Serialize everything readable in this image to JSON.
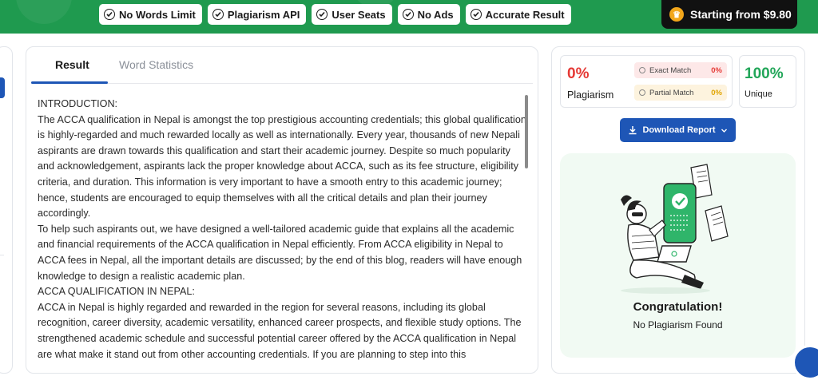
{
  "banner": {
    "features": [
      "No Words Limit",
      "Plagiarism API",
      "User Seats",
      "No Ads",
      "Accurate Result"
    ],
    "promo_label": "Starting from $9.80",
    "accent": "#1f9a4f"
  },
  "tabs": {
    "result": "Result",
    "word_statistics": "Word Statistics"
  },
  "result_text": [
    "INTRODUCTION:",
    "The ACCA qualification in Nepal is amongst the top prestigious accounting credentials; this global qualification is highly-regarded and much rewarded locally as well as internationally. Every year, thousands of new Nepali aspirants are drawn towards this qualification and start their academic journey. Despite so much popularity and acknowledgement, aspirants lack the proper knowledge about ACCA, such as its fee structure, eligibility criteria, and duration. This information is very important to have a smooth entry to this academic journey; hence, students are encouraged to equip themselves with all the critical details and plan their journey accordingly.",
    "To help such aspirants out, we have designed a well-tailored academic guide that explains all the academic and financial requirements of the ACCA qualification in Nepal efficiently. From ACCA eligibility in Nepal to ACCA fees in Nepal, all the important details are discussed; by the end of this blog, readers will have enough knowledge to design a realistic academic plan.",
    "ACCA QUALIFICATION IN NEPAL:",
    "ACCA in Nepal is highly regarded and rewarded in the region for several reasons, including its global recognition, career diversity, academic versatility, enhanced career prospects, and flexible study options. The strengthened academic schedule and successful potential career offered by the ACCA qualification in Nepal are what make it stand out from other accounting credentials. If you are planning to step into this"
  ],
  "report": {
    "plagiarism_pct": "0%",
    "plagiarism_label": "Plagiarism",
    "exact_match_label": "Exact Match",
    "exact_match_value": "0%",
    "partial_match_label": "Partial Match",
    "partial_match_value": "0%",
    "unique_pct": "100%",
    "unique_label": "Unique",
    "download_label": "Download Report",
    "congrats_title": "Congratulation!",
    "congrats_sub": "No Plagiarism Found"
  }
}
